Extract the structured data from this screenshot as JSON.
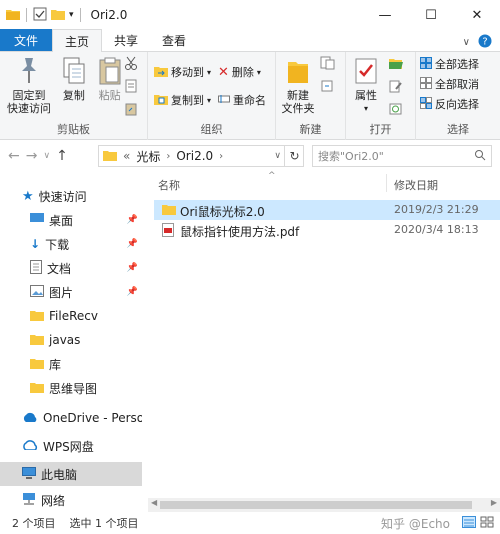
{
  "window": {
    "title": "Ori2.0",
    "controls": [
      "minimize",
      "maximize",
      "close"
    ]
  },
  "tabs": [
    {
      "label": "文件",
      "style": "file"
    },
    {
      "label": "主页",
      "style": "active"
    },
    {
      "label": "共享",
      "style": ""
    },
    {
      "label": "查看",
      "style": ""
    }
  ],
  "ribbon": {
    "clipboard": {
      "pin_label_1": "固定到",
      "pin_label_2": "快速访问",
      "copy": "复制",
      "paste": "粘贴",
      "group": "剪贴板"
    },
    "organize": {
      "move_to": "移动到",
      "copy_to": "复制到",
      "delete": "删除",
      "rename": "重命名",
      "group": "组织"
    },
    "new": {
      "new_folder_1": "新建",
      "new_folder_2": "文件夹",
      "group": "新建"
    },
    "open": {
      "properties": "属性",
      "group": "打开"
    },
    "select": {
      "select_all": "全部选择",
      "select_none": "全部取消",
      "invert": "反向选择",
      "group": "选择"
    }
  },
  "address": {
    "prefix": "«",
    "crumbs": [
      "光标",
      "Ori2.0"
    ]
  },
  "search": {
    "placeholder": "搜索\"Ori2.0\""
  },
  "navpane": [
    {
      "label": "快速访问",
      "icon": "star-icon",
      "pinned": false
    },
    {
      "label": "桌面",
      "icon": "desktop-icon",
      "pinned": true
    },
    {
      "label": "下载",
      "icon": "download-icon",
      "pinned": true
    },
    {
      "label": "文档",
      "icon": "document-icon",
      "pinned": true
    },
    {
      "label": "图片",
      "icon": "picture-icon",
      "pinned": true
    },
    {
      "label": "FileRecv",
      "icon": "folder-icon",
      "pinned": false
    },
    {
      "label": "javas",
      "icon": "folder-icon",
      "pinned": false
    },
    {
      "label": "库",
      "icon": "folder-icon",
      "pinned": false
    },
    {
      "label": "思维导图",
      "icon": "folder-icon",
      "pinned": false
    },
    {
      "label": "OneDrive - Persona",
      "icon": "cloud-icon",
      "pinned": false
    },
    {
      "label": "WPS网盘",
      "icon": "cloud-icon",
      "pinned": false
    },
    {
      "label": "此电脑",
      "icon": "computer-icon",
      "pinned": false,
      "selected": true
    },
    {
      "label": "网络",
      "icon": "network-icon",
      "pinned": false
    }
  ],
  "columns": {
    "name": "名称",
    "date": "修改日期"
  },
  "files": [
    {
      "name": "Ori鼠标光标2.0",
      "date": "2019/2/3 21:29",
      "type": "folder",
      "selected": true
    },
    {
      "name": "鼠标指针使用方法.pdf",
      "date": "2020/3/4 18:13",
      "type": "pdf",
      "selected": false
    }
  ],
  "status": {
    "count": "2 个项目",
    "selected": "选中 1 个项目"
  },
  "watermark": "知乎 @Echo",
  "colors": {
    "accent": "#1979ca",
    "selection": "#cce8ff",
    "folder": "#f8c93e"
  }
}
